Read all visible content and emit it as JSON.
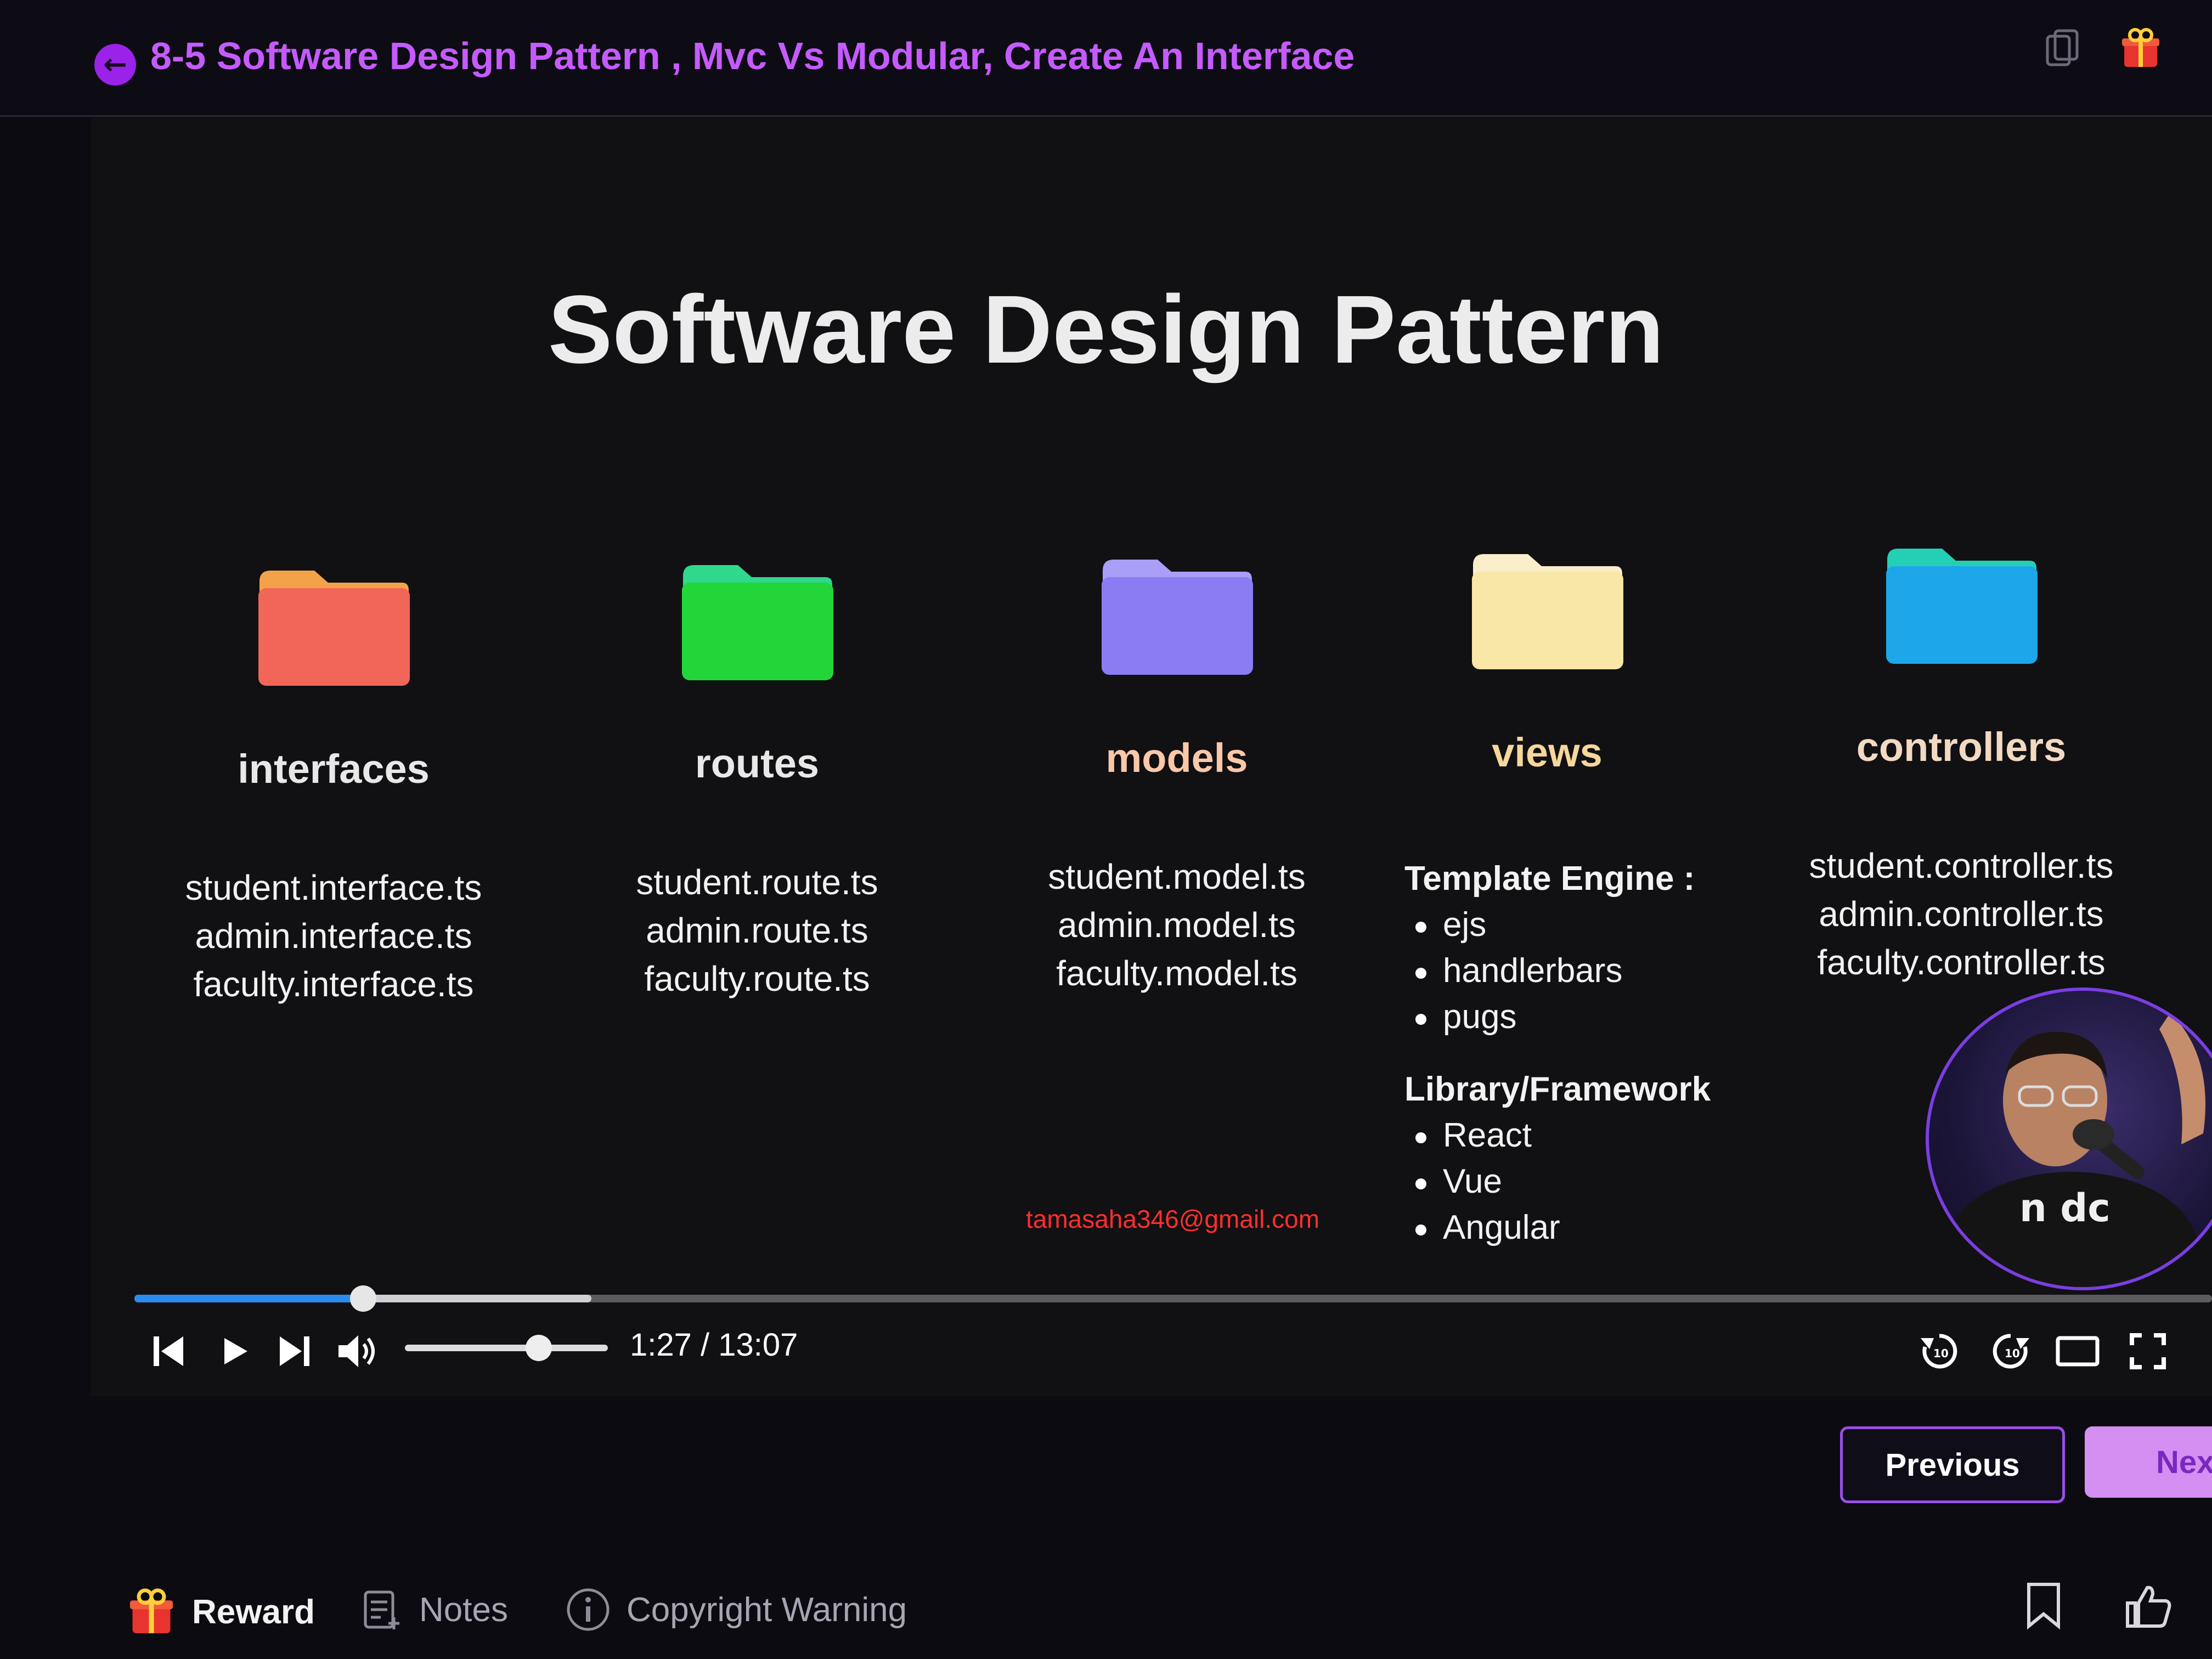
{
  "header": {
    "back_icon": "arrow-left-icon",
    "title": "8-5 Software Design Pattern , Mvc Vs Modular, Create An Interface",
    "copy_icon": "copy-icon",
    "gift_icon": "gift-icon"
  },
  "slide": {
    "title": "Software Design Pattern",
    "folders": [
      {
        "name": "interfaces",
        "color": "#f2665a",
        "tab_color": "#f4a24a",
        "label_color": "#e8e8e8",
        "files": [
          "student.interface.ts",
          "admin.interface.ts",
          "faculty.interface.ts"
        ]
      },
      {
        "name": "routes",
        "color": "#22d63a",
        "tab_color": "#2fd88c",
        "label_color": "#e8e8e8",
        "files": [
          "student.route.ts",
          "admin.route.ts",
          "faculty.route.ts"
        ]
      },
      {
        "name": "models",
        "color": "#8b7cf3",
        "tab_color": "#a99ef8",
        "label_color": "#f9c8a8",
        "files": [
          "student.model.ts",
          "admin.model.ts",
          "faculty.model.ts"
        ]
      },
      {
        "name": "views",
        "color": "#f8e7a6",
        "tab_color": "#faeecb",
        "label_color": "#f6d79a",
        "files": []
      },
      {
        "name": "controllers",
        "color": "#1ea6ea",
        "tab_color": "#23d0b6",
        "label_color": "#f2d9c2",
        "files": [
          "student.controller.ts",
          "admin.controller.ts",
          "faculty.controller.ts"
        ]
      }
    ],
    "views_details": {
      "template_header": "Template Engine :",
      "template_items": [
        "ejs",
        "handlerbars",
        "pugs"
      ],
      "library_header": "Library/Framework",
      "library_items": [
        "React",
        "Vue",
        "Angular"
      ]
    },
    "watermark": "tamasaha346@gmail.com"
  },
  "player": {
    "progress": 0.11,
    "buffered": 0.22,
    "volume": 0.66,
    "time": "1:27 / 13:07",
    "controls": [
      "skip-previous-icon",
      "play-icon",
      "skip-next-icon",
      "volume-icon",
      "rewind-10-icon",
      "forward-10-icon",
      "theater-mode-icon",
      "fullscreen-icon"
    ]
  },
  "navigation": {
    "previous_label": "Previous",
    "next_label": "Nex"
  },
  "bottom": {
    "reward_label": "Reward",
    "notes_label": "Notes",
    "copyright_label": "Copyright Warning"
  },
  "colors": {
    "accent": "#9b22e8",
    "title_purple": "#c55bff",
    "progress_blue": "#2b8cf0"
  }
}
